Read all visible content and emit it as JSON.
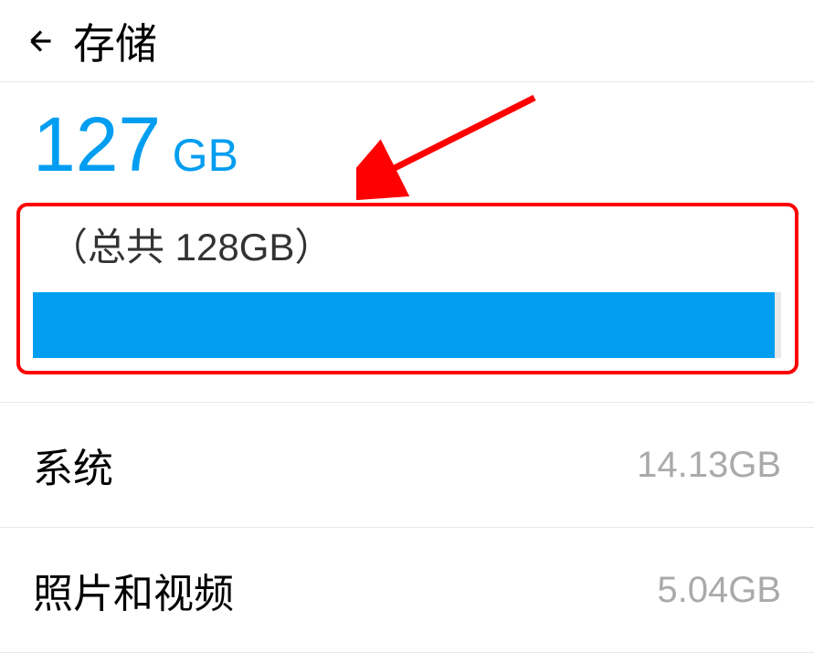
{
  "header": {
    "title": "存储"
  },
  "storage": {
    "used_number": "127",
    "used_unit": "GB",
    "total_text": "（总共 128GB）",
    "progress_percent": 99.2
  },
  "items": [
    {
      "label": "系统",
      "value": "14.13GB"
    },
    {
      "label": "照片和视频",
      "value": "5.04GB"
    }
  ]
}
